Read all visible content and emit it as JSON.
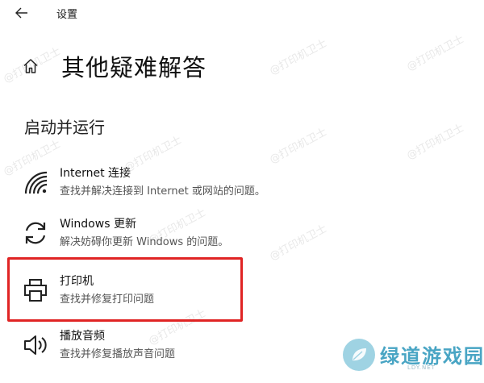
{
  "window": {
    "title": "设置"
  },
  "header": {
    "title": "其他疑难解答"
  },
  "section": {
    "title": "启动并运行"
  },
  "items": [
    {
      "name": "Internet 连接",
      "desc": "查找并解决连接到 Internet 或网站的问题。",
      "icon": "wifi-icon"
    },
    {
      "name": "Windows 更新",
      "desc": "解决妨碍你更新 Windows 的问题。",
      "icon": "sync-icon"
    },
    {
      "name": "打印机",
      "desc": "查找并修复打印问题",
      "icon": "printer-icon"
    },
    {
      "name": "播放音频",
      "desc": "查找并修复播放声音问题",
      "icon": "speaker-icon"
    }
  ],
  "watermarks": [
    "@打印机卫士",
    "@打印机卫士",
    "@打印机卫士",
    "@打印机卫士",
    "@打印机卫士",
    "@打印机卫士",
    "@打印机卫士",
    "@打印机卫士",
    "@打印机卫士",
    "@打印机卫士"
  ],
  "brand": {
    "name": "绿道游戏园",
    "url": "LDY.NET"
  },
  "colors": {
    "highlight": "#e02424",
    "brand": "#49a5c4"
  }
}
